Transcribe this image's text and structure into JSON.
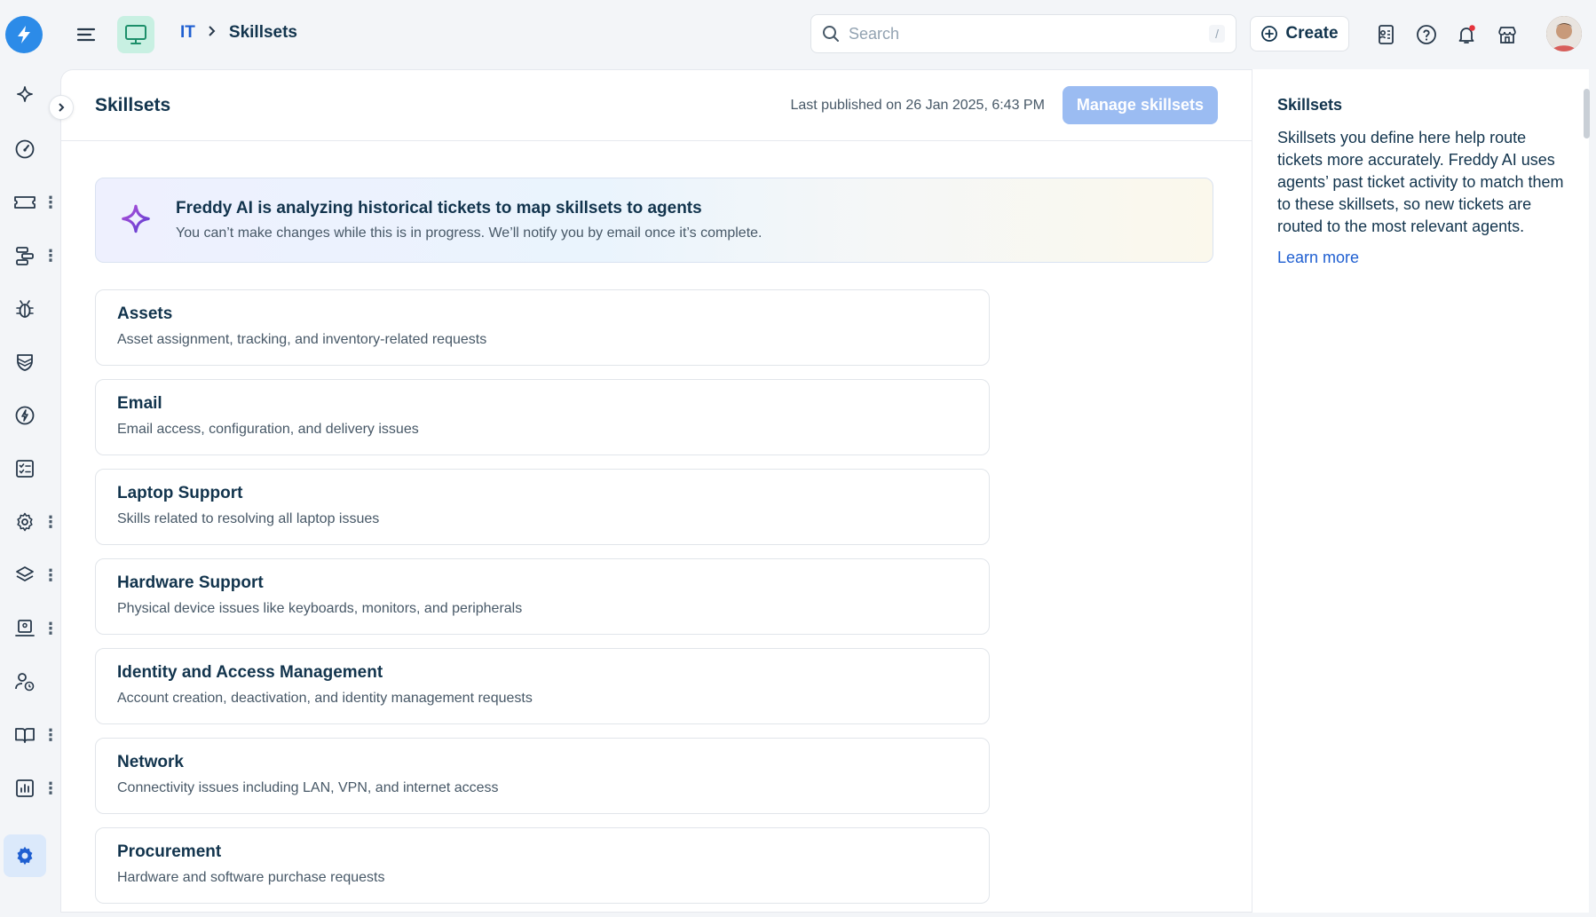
{
  "app": {
    "brand_color": "#2c8be8",
    "accent": "#1f5fd1"
  },
  "header": {
    "breadcrumb": [
      "IT",
      "Skillsets"
    ],
    "search": {
      "placeholder": "Search",
      "shortcut": "/"
    },
    "create_label": "Create",
    "icons": [
      "menu-icon",
      "monitor-icon",
      "contact-card-icon",
      "help-icon",
      "bell-icon",
      "store-icon"
    ]
  },
  "sidebar": {
    "items": [
      {
        "icon": "sparkle-icon"
      },
      {
        "icon": "dashboard-icon"
      },
      {
        "icon": "ticket-icon",
        "more": true
      },
      {
        "icon": "workflow-icon",
        "more": true
      },
      {
        "icon": "bug-icon"
      },
      {
        "icon": "shield-icon"
      },
      {
        "icon": "bolt-circle-icon"
      },
      {
        "icon": "checklist-icon"
      },
      {
        "icon": "cog-icon",
        "more": true
      },
      {
        "icon": "layers-icon",
        "more": true
      },
      {
        "icon": "laptop-user-icon",
        "more": true
      },
      {
        "icon": "user-clock-icon"
      },
      {
        "icon": "book-icon",
        "more": true
      },
      {
        "icon": "reports-icon",
        "more": true
      },
      {
        "icon": "settings-icon",
        "active": true
      }
    ]
  },
  "main": {
    "title": "Skillsets",
    "last_published": "Last published on 26 Jan 2025, 6:43 PM",
    "manage_button": "Manage skillsets",
    "banner": {
      "title": "Freddy AI is analyzing historical tickets to map skillsets to agents",
      "subtitle": "You can’t make changes while this is in progress. We’ll notify you by email once it’s complete."
    },
    "skillsets": [
      {
        "name": "Assets",
        "description": "Asset assignment, tracking, and inventory-related requests"
      },
      {
        "name": "Email",
        "description": "Email access, configuration, and delivery issues"
      },
      {
        "name": "Laptop Support",
        "description": "Skills related to resolving all laptop issues"
      },
      {
        "name": "Hardware Support",
        "description": "Physical device issues like keyboards, monitors, and peripherals"
      },
      {
        "name": "Identity and Access Management",
        "description": "Account creation, deactivation, and identity management requests"
      },
      {
        "name": "Network",
        "description": "Connectivity issues including LAN, VPN, and internet access"
      },
      {
        "name": "Procurement",
        "description": "Hardware and software purchase requests"
      }
    ]
  },
  "help_panel": {
    "title": "Skillsets",
    "body": "Skillsets you define here help route tickets more accurately. Freddy AI uses agents’ past ticket activity to match them to these skillsets, so new tickets are routed to the most relevant agents.",
    "link": "Learn more"
  }
}
